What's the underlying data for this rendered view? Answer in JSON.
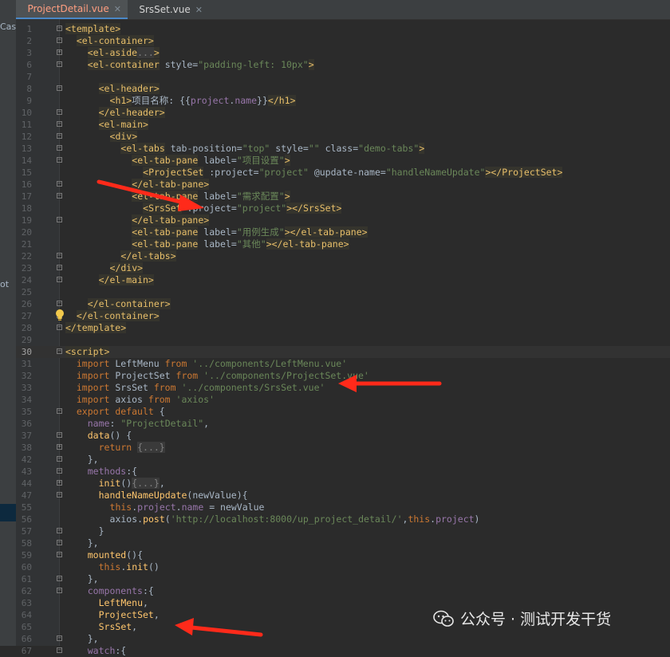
{
  "tabs": [
    {
      "label": "ProjectDetail.vue",
      "active": true,
      "color": "#ff9e80"
    },
    {
      "label": "SrsSet.vue",
      "active": false,
      "color": "#d4d4d4"
    }
  ],
  "side_labels": [
    "Cas",
    "ot"
  ],
  "colors": {
    "tag": "#e8bf6a",
    "attr": "#bababa",
    "string": "#6a8759",
    "keyword": "#cc7832",
    "field": "#9876aa",
    "func": "#ffc66d",
    "text": "#a9b7c6",
    "arrow": "#ff2a1a",
    "vue_green": "#41b883",
    "vue_dark": "#35495e",
    "vue_orange": "#e07a3a"
  },
  "editor": {
    "caret_line": "30",
    "lines": [
      {
        "n": "1",
        "indent": 0,
        "fold": "-",
        "segs": [
          [
            "t",
            "<template>"
          ]
        ]
      },
      {
        "n": "2",
        "indent": 2,
        "fold": "-",
        "segs": [
          [
            "t",
            "<el-container>"
          ]
        ]
      },
      {
        "n": "3",
        "indent": 4,
        "fold": "+",
        "segs": [
          [
            "t",
            "<el-aside"
          ],
          [
            "c",
            "..."
          ],
          [
            "t",
            ">"
          ]
        ]
      },
      {
        "n": "6",
        "indent": 4,
        "fold": "-",
        "segs": [
          [
            "t",
            "<el-container"
          ],
          [
            "p",
            " style="
          ],
          [
            "s",
            "\"padding-left: 10px\""
          ],
          [
            "t",
            ">"
          ]
        ]
      },
      {
        "n": "7",
        "indent": 0,
        "fold": "",
        "segs": []
      },
      {
        "n": "8",
        "indent": 6,
        "fold": "-",
        "segs": [
          [
            "t",
            "<el-header>"
          ]
        ]
      },
      {
        "n": "9",
        "indent": 8,
        "fold": "",
        "segs": [
          [
            "t",
            "<h1>"
          ],
          [
            "p",
            "项目名称: {{"
          ],
          [
            "f",
            "project"
          ],
          [
            "p",
            "."
          ],
          [
            "f",
            "name"
          ],
          [
            "p",
            "}}"
          ],
          [
            "t",
            "</h1>"
          ]
        ]
      },
      {
        "n": "10",
        "indent": 6,
        "fold": "-",
        "segs": [
          [
            "t",
            "</el-header>"
          ]
        ]
      },
      {
        "n": "11",
        "indent": 6,
        "fold": "-",
        "segs": [
          [
            "t",
            "<el-main>"
          ]
        ]
      },
      {
        "n": "12",
        "indent": 8,
        "fold": "-",
        "segs": [
          [
            "t",
            "<div>"
          ]
        ]
      },
      {
        "n": "13",
        "indent": 10,
        "fold": "-",
        "segs": [
          [
            "t",
            "<el-tabs"
          ],
          [
            "p",
            " tab-position="
          ],
          [
            "s",
            "\"top\""
          ],
          [
            "p",
            " style="
          ],
          [
            "s",
            "\"\""
          ],
          [
            "p",
            " class="
          ],
          [
            "s",
            "\"demo-tabs\""
          ],
          [
            "t",
            ">"
          ]
        ]
      },
      {
        "n": "14",
        "indent": 12,
        "fold": "-",
        "segs": [
          [
            "t",
            "<el-tab-pane"
          ],
          [
            "p",
            " label="
          ],
          [
            "s",
            "\"项目设置\""
          ],
          [
            "t",
            ">"
          ]
        ]
      },
      {
        "n": "15",
        "indent": 14,
        "fold": "",
        "segs": [
          [
            "t",
            "<ProjectSet"
          ],
          [
            "p",
            " :project="
          ],
          [
            "s",
            "\"project\""
          ],
          [
            "p",
            " @update-name="
          ],
          [
            "s",
            "\"handleNameUpdate\""
          ],
          [
            "t",
            "></ProjectSet>"
          ]
        ]
      },
      {
        "n": "16",
        "indent": 12,
        "fold": "-",
        "segs": [
          [
            "t",
            "</el-tab-pane>"
          ]
        ]
      },
      {
        "n": "17",
        "indent": 12,
        "fold": "-",
        "segs": [
          [
            "t",
            "<el-tab-pane"
          ],
          [
            "p",
            " label="
          ],
          [
            "s",
            "\"需求配置\""
          ],
          [
            "t",
            ">"
          ]
        ]
      },
      {
        "n": "18",
        "indent": 14,
        "fold": "",
        "segs": [
          [
            "t",
            "<SrsSet"
          ],
          [
            "p",
            " :project="
          ],
          [
            "s",
            "\"project\""
          ],
          [
            "t",
            "></SrsSet>"
          ]
        ]
      },
      {
        "n": "19",
        "indent": 12,
        "fold": "-",
        "segs": [
          [
            "t",
            "</el-tab-pane>"
          ]
        ]
      },
      {
        "n": "20",
        "indent": 12,
        "fold": "",
        "segs": [
          [
            "t",
            "<el-tab-pane"
          ],
          [
            "p",
            " label="
          ],
          [
            "s",
            "\"用例生成\""
          ],
          [
            "t",
            "></el-tab-pane>"
          ]
        ]
      },
      {
        "n": "21",
        "indent": 12,
        "fold": "",
        "segs": [
          [
            "t",
            "<el-tab-pane"
          ],
          [
            "p",
            " label="
          ],
          [
            "s",
            "\"其他\""
          ],
          [
            "t",
            "></el-tab-pane>"
          ]
        ]
      },
      {
        "n": "22",
        "indent": 10,
        "fold": "-",
        "segs": [
          [
            "t",
            "</el-tabs>"
          ]
        ]
      },
      {
        "n": "23",
        "indent": 8,
        "fold": "-",
        "segs": [
          [
            "t",
            "</div>"
          ]
        ]
      },
      {
        "n": "24",
        "indent": 6,
        "fold": "-",
        "segs": [
          [
            "t",
            "</el-main>"
          ]
        ]
      },
      {
        "n": "25",
        "indent": 0,
        "fold": "",
        "segs": []
      },
      {
        "n": "26",
        "indent": 4,
        "fold": "-",
        "segs": [
          [
            "t",
            "</el-container>"
          ]
        ]
      },
      {
        "n": "27",
        "indent": 2,
        "fold": "-",
        "segs": [
          [
            "t",
            "</el-container>"
          ]
        ]
      },
      {
        "n": "28",
        "indent": 0,
        "fold": "-",
        "segs": [
          [
            "t",
            "</template>"
          ]
        ]
      },
      {
        "n": "29",
        "indent": 0,
        "fold": "",
        "segs": []
      },
      {
        "n": "30",
        "indent": 0,
        "fold": "-",
        "segs": [
          [
            "t",
            "<script>"
          ]
        ]
      },
      {
        "n": "31",
        "indent": 2,
        "fold": "",
        "segs": [
          [
            "k",
            "import"
          ],
          [
            "p",
            " LeftMenu "
          ],
          [
            "k",
            "from"
          ],
          [
            "s",
            " '../components/LeftMenu.vue'"
          ]
        ]
      },
      {
        "n": "32",
        "indent": 2,
        "fold": "",
        "segs": [
          [
            "k",
            "import"
          ],
          [
            "p",
            " ProjectSet "
          ],
          [
            "k",
            "from"
          ],
          [
            "s",
            " '../components/ProjectSet.vue'"
          ]
        ]
      },
      {
        "n": "33",
        "indent": 2,
        "fold": "",
        "segs": [
          [
            "k",
            "import"
          ],
          [
            "p",
            " SrsSet "
          ],
          [
            "k",
            "from"
          ],
          [
            "s",
            " '../components/SrsSet.vue'"
          ]
        ]
      },
      {
        "n": "34",
        "indent": 2,
        "fold": "",
        "segs": [
          [
            "k",
            "import"
          ],
          [
            "p",
            " axios "
          ],
          [
            "k",
            "from"
          ],
          [
            "s",
            " 'axios'"
          ]
        ]
      },
      {
        "n": "35",
        "indent": 2,
        "fold": "-",
        "segs": [
          [
            "k",
            "export default"
          ],
          [
            "p",
            " {"
          ]
        ]
      },
      {
        "n": "36",
        "indent": 4,
        "fold": "",
        "segs": [
          [
            "f",
            "name"
          ],
          [
            "p",
            ": "
          ],
          [
            "s",
            "\"ProjectDetail\""
          ],
          [
            "p",
            ","
          ]
        ]
      },
      {
        "n": "37",
        "indent": 4,
        "fold": "-",
        "segs": [
          [
            "u",
            "data"
          ],
          [
            "p",
            "() {"
          ]
        ]
      },
      {
        "n": "38",
        "indent": 6,
        "fold": "+",
        "segs": [
          [
            "k",
            "return"
          ],
          [
            "p",
            " "
          ],
          [
            "c",
            "{...}"
          ]
        ]
      },
      {
        "n": "42",
        "indent": 4,
        "fold": "-",
        "segs": [
          [
            "p",
            "},"
          ]
        ]
      },
      {
        "n": "43",
        "indent": 4,
        "fold": "-",
        "segs": [
          [
            "f",
            "methods"
          ],
          [
            "p",
            ":{"
          ]
        ]
      },
      {
        "n": "44",
        "indent": 6,
        "fold": "+",
        "segs": [
          [
            "u",
            "init"
          ],
          [
            "p",
            "()"
          ],
          [
            "c",
            "{...}"
          ],
          [
            "p",
            ","
          ]
        ]
      },
      {
        "n": "47",
        "indent": 6,
        "fold": "-",
        "segs": [
          [
            "u",
            "handleNameUpdate"
          ],
          [
            "p",
            "(newValue){"
          ]
        ]
      },
      {
        "n": "55",
        "indent": 8,
        "fold": "",
        "segs": [
          [
            "k",
            "this"
          ],
          [
            "p",
            "."
          ],
          [
            "f",
            "project"
          ],
          [
            "p",
            "."
          ],
          [
            "f",
            "name"
          ],
          [
            "p",
            " = newValue"
          ]
        ]
      },
      {
        "n": "56",
        "indent": 8,
        "fold": "",
        "segs": [
          [
            "p",
            "axios."
          ],
          [
            "u",
            "post"
          ],
          [
            "p",
            "("
          ],
          [
            "s",
            "'http://localhost:8000/up_project_detail/'"
          ],
          [
            "p",
            ","
          ],
          [
            "k",
            "this"
          ],
          [
            "p",
            "."
          ],
          [
            "f",
            "project"
          ],
          [
            "p",
            ")"
          ]
        ]
      },
      {
        "n": "57",
        "indent": 6,
        "fold": "-",
        "segs": [
          [
            "p",
            "}"
          ]
        ]
      },
      {
        "n": "58",
        "indent": 4,
        "fold": "-",
        "segs": [
          [
            "p",
            "},"
          ]
        ]
      },
      {
        "n": "59",
        "indent": 4,
        "fold": "-",
        "segs": [
          [
            "u",
            "mounted"
          ],
          [
            "p",
            "(){"
          ]
        ]
      },
      {
        "n": "60",
        "indent": 6,
        "fold": "",
        "segs": [
          [
            "k",
            "this"
          ],
          [
            "p",
            "."
          ],
          [
            "u",
            "init"
          ],
          [
            "p",
            "()"
          ]
        ]
      },
      {
        "n": "61",
        "indent": 4,
        "fold": "-",
        "segs": [
          [
            "p",
            "},"
          ]
        ]
      },
      {
        "n": "62",
        "indent": 4,
        "fold": "-",
        "segs": [
          [
            "f",
            "components"
          ],
          [
            "p",
            ":{"
          ]
        ]
      },
      {
        "n": "63",
        "indent": 6,
        "fold": "",
        "segs": [
          [
            "u",
            "LeftMenu"
          ],
          [
            "p",
            ","
          ]
        ]
      },
      {
        "n": "64",
        "indent": 6,
        "fold": "",
        "segs": [
          [
            "u",
            "ProjectSet"
          ],
          [
            "p",
            ","
          ]
        ]
      },
      {
        "n": "65",
        "indent": 6,
        "fold": "",
        "segs": [
          [
            "u",
            "SrsSet"
          ],
          [
            "p",
            ","
          ]
        ]
      },
      {
        "n": "66",
        "indent": 4,
        "fold": "-",
        "segs": [
          [
            "p",
            "},"
          ]
        ]
      },
      {
        "n": "67",
        "indent": 4,
        "fold": "-",
        "segs": [
          [
            "f",
            "watch"
          ],
          [
            "p",
            ":{"
          ]
        ]
      }
    ]
  },
  "annotations": [
    {
      "name": "arrow-to-srsset-tag"
    },
    {
      "name": "arrow-to-srsset-import"
    },
    {
      "name": "arrow-to-srsset-component"
    }
  ],
  "watermark": {
    "text": "公众号 · 测试开发干货",
    "logo": "wechat-icon"
  }
}
